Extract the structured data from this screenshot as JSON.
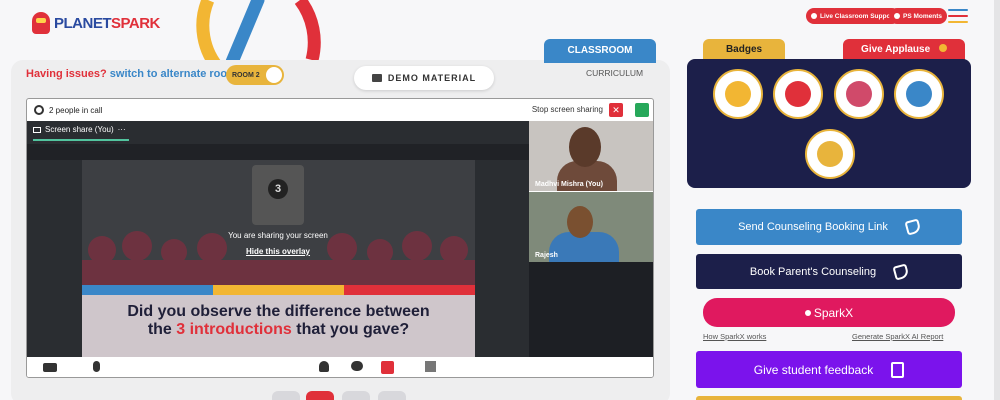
{
  "header": {
    "logo": {
      "a": "PLANET",
      "b": "SPARK"
    },
    "live_support": "Live Classroom Support",
    "ps_moments": "PS Moments"
  },
  "room": {
    "issues_text": "Having issues?",
    "switch_text": "switch to alternate room",
    "toggle_label": "ROOM 2",
    "demo_label": "DEMO MATERIAL"
  },
  "tabs": {
    "classroom": "CLASSROOM",
    "curriculum": "CURRICULUM"
  },
  "call": {
    "people": "2 people in call",
    "stop_share": "Stop screen sharing",
    "share_tab": "Screen share (You)",
    "overlay_title": "You are sharing your screen",
    "overlay_hide": "Hide this overlay",
    "slide_num": "3",
    "slide_line1": "Did you observe the difference between",
    "slide_line2_a": "the ",
    "slide_line2_red": "3 introductions",
    "slide_line2_b": " that you gave?",
    "participants": [
      {
        "name": "Madhvi Mishra (You)"
      },
      {
        "name": "Rajesh"
      }
    ]
  },
  "side": {
    "badges_tab": "Badges",
    "applause_tab": "Give Applause",
    "send_counseling": "Send Counseling Booking Link",
    "book_counseling": "Book Parent's Counseling",
    "sparkx": "SparkX",
    "how_sparkx": "How SparkX works",
    "generate_report": "Generate SparkX AI Report",
    "feedback": "Give student feedback"
  },
  "colors": {
    "red": "#e0303a",
    "blue": "#3a87c8",
    "navy": "#1c1f4a",
    "gold": "#e8b43c",
    "purple": "#7b13ec",
    "pink": "#e0195f"
  }
}
